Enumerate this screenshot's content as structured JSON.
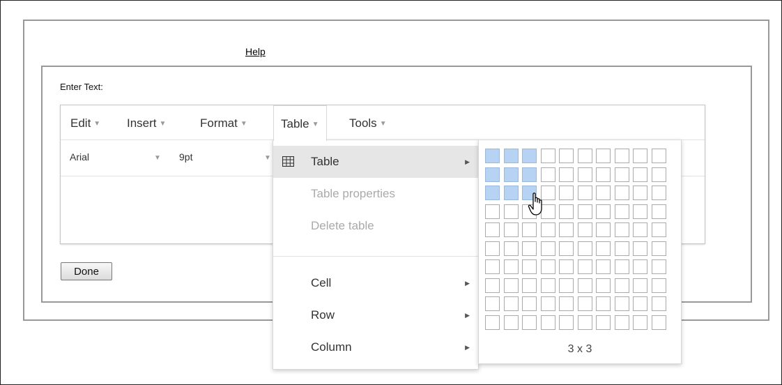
{
  "help": {
    "label": "Help"
  },
  "form": {
    "enter_text_label": "Enter Text:",
    "done_label": "Done"
  },
  "menubar": [
    {
      "label": "Edit",
      "active": false
    },
    {
      "label": "Insert",
      "active": false
    },
    {
      "label": "Format",
      "active": false
    },
    {
      "label": "Table",
      "active": true
    },
    {
      "label": "Tools",
      "active": false
    }
  ],
  "toolbar": {
    "font_family": "Arial",
    "font_size": "9pt"
  },
  "table_menu": {
    "items": [
      {
        "label": "Table",
        "icon": "table-icon",
        "submenu": true,
        "disabled": false,
        "highlighted": true
      },
      {
        "label": "Table properties",
        "submenu": false,
        "disabled": true,
        "highlighted": false
      },
      {
        "label": "Delete table",
        "submenu": false,
        "disabled": true,
        "highlighted": false
      },
      {
        "label": "Cell",
        "submenu": true,
        "disabled": false,
        "highlighted": false
      },
      {
        "label": "Row",
        "submenu": true,
        "disabled": false,
        "highlighted": false
      },
      {
        "label": "Column",
        "submenu": true,
        "disabled": false,
        "highlighted": false
      }
    ]
  },
  "table_grid": {
    "rows": 10,
    "cols": 10,
    "selected_rows": 3,
    "selected_cols": 3,
    "size_label": "3 x 3"
  },
  "colors": {
    "selected_cell": "#b7d3f3",
    "cell_border": "#aaaaaa",
    "highlight": "#e6e6e6"
  }
}
